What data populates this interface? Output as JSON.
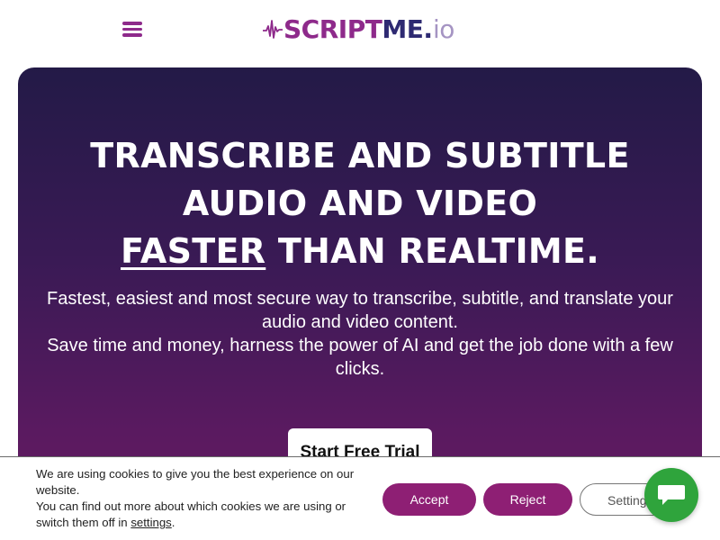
{
  "header": {
    "menu_icon": "hamburger-menu-icon",
    "logo": {
      "script": "SCRIPT",
      "me": "ME",
      "dot": ".",
      "io": "io",
      "wave_icon": "audio-wave-icon"
    }
  },
  "hero": {
    "title_line1": "TRANSCRIBE AND SUBTITLE",
    "title_line2": "AUDIO AND VIDEO",
    "title_line3_underlined": "FASTER",
    "title_line3_rest": " THAN REALTIME.",
    "subtitle_p1": "Fastest, easiest and most secure way to transcribe, subtitle, and translate your audio and video content.",
    "subtitle_p2": "Save time and money, harness the power of AI and get the job done with a few clicks.",
    "cta_label": "Start Free Trial"
  },
  "cookie_bar": {
    "text_1": "We are using cookies to give you the best experience on our website.",
    "text_2": "You can find out more about which cookies we are using or switch them off in ",
    "settings_link": "settings",
    "text_end": ".",
    "accept_label": "Accept",
    "reject_label": "Reject",
    "settings_label": "Settings"
  },
  "chat": {
    "icon": "chat-bubble-icon"
  },
  "colors": {
    "brand_purple": "#8e2a8b",
    "brand_navy": "#2e2a72",
    "cookie_button": "#8e1f74",
    "chat_green": "#2fa43c"
  }
}
